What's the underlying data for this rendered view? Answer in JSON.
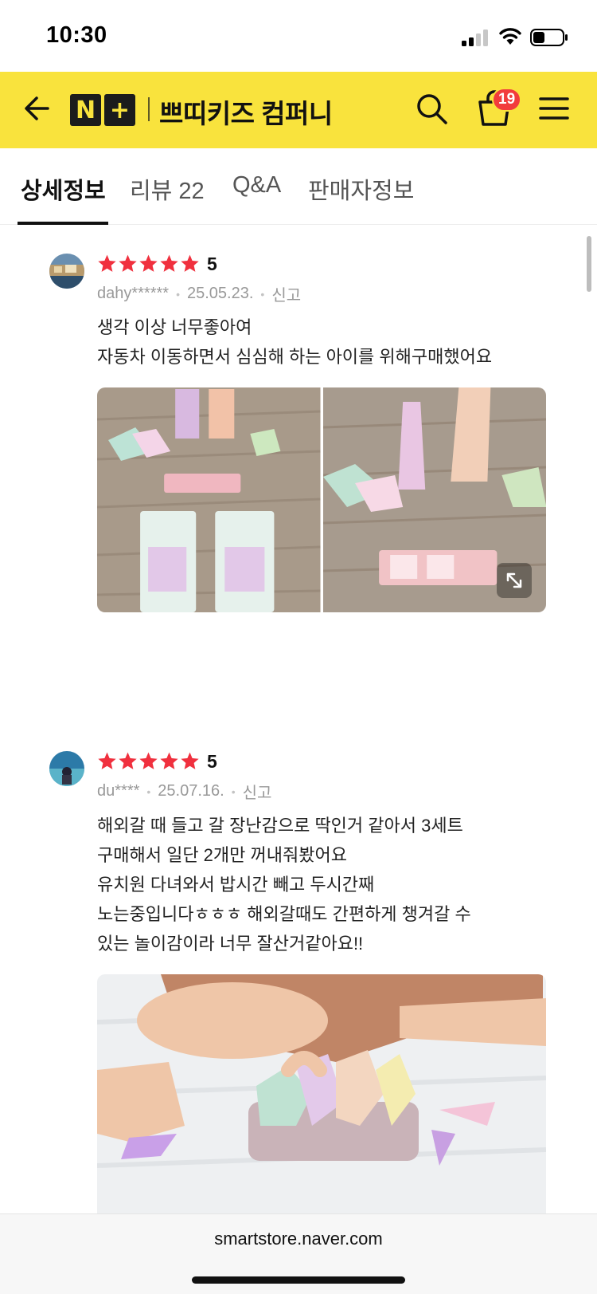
{
  "status_bar": {
    "time": "10:30"
  },
  "header": {
    "logo_letter": "N",
    "logo_plus": "+",
    "store_name": "쁘띠키즈 컴퍼니",
    "cart_badge": "19",
    "bg_color": "#f9e33d"
  },
  "tabs": [
    {
      "label": "상세정보",
      "active": true
    },
    {
      "label": "리뷰 22",
      "active": false
    },
    {
      "label": "Q&A",
      "active": false
    },
    {
      "label": "판매자정보",
      "active": false
    }
  ],
  "reviews": [
    {
      "stars": 5,
      "rating": "5",
      "user": "dahy******",
      "date": "25.05.23.",
      "report": "신고",
      "lines": [
        "생각 이상 너무좋아여",
        "자동차 이동하면서 심심해 하는 아이를 위해구매했어요"
      ]
    },
    {
      "stars": 5,
      "rating": "5",
      "user": "du****",
      "date": "25.07.16.",
      "report": "신고",
      "lines": [
        "해외갈 때 들고 갈 장난감으로 딱인거 같아서 3세트",
        "구매해서 일단 2개만 꺼내줘봤어요",
        "유치원 다녀와서 밥시간 빼고 두시간째",
        "노는중입니다ㅎㅎㅎ 해외갈때도 간편하게 챙겨갈 수",
        "있는 놀이감이라 너무 잘산거같아요!!"
      ]
    }
  ],
  "bottom_bar": {
    "url": "smartstore.naver.com"
  },
  "colors": {
    "star": "#f0303e",
    "accent": "#f9e33d",
    "badge": "#f23c3c"
  }
}
